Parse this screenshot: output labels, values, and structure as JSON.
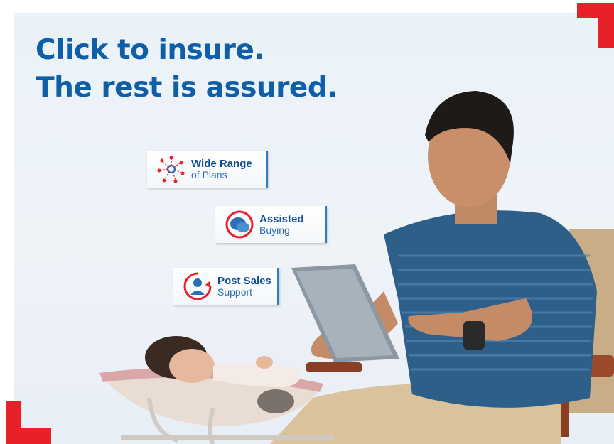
{
  "headline": {
    "line1": "Click to insure.",
    "line2": "The rest is assured."
  },
  "badges": [
    {
      "strong": "Wide Range",
      "light": "of Plans",
      "icon": "network-icon"
    },
    {
      "strong": "Assisted",
      "light": "Buying",
      "icon": "chat-bubble-icon"
    },
    {
      "strong": "Post Sales",
      "light": "Support",
      "icon": "support-person-icon"
    }
  ],
  "colors": {
    "brand_blue": "#0f5ea8",
    "accent_red": "#e8202a"
  }
}
